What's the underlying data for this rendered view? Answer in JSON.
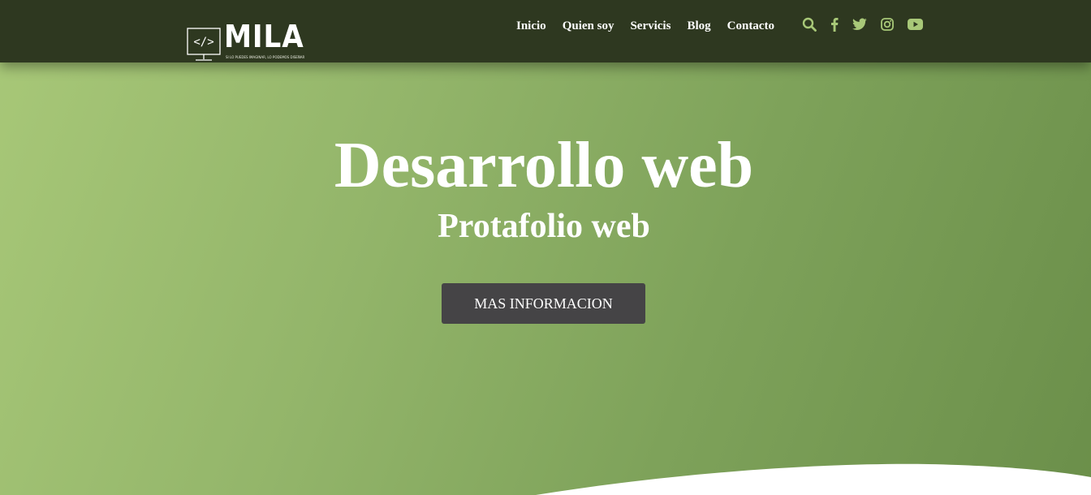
{
  "brand": {
    "logo_code": "</>",
    "name": "MILA",
    "tagline": "SI LO PUEDES IMAGINAR, LO PODEMOS DISEÑAR"
  },
  "nav": {
    "links": [
      {
        "label": "Inicio"
      },
      {
        "label": "Quien soy"
      },
      {
        "label": "Servicis"
      },
      {
        "label": "Blog"
      },
      {
        "label": "Contacto"
      }
    ],
    "icons": [
      "search-icon",
      "facebook-icon",
      "twitter-icon",
      "instagram-icon",
      "youtube-icon"
    ]
  },
  "hero": {
    "title": "Desarrollo web",
    "subtitle": "Protafolio web",
    "cta_label": "MAS INFORMACION"
  },
  "colors": {
    "navbar": "#2e3820",
    "accent_icons": "#a8c878",
    "hero_gradient_start": "#a8c878",
    "hero_gradient_end": "#6b8f4a",
    "button": "#454446",
    "wave": "#ffffff"
  }
}
